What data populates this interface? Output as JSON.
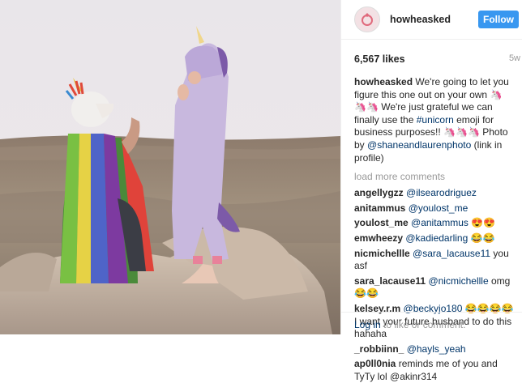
{
  "account": {
    "username": "howheasked",
    "follow_label": "Follow"
  },
  "post": {
    "likes": "6,567 likes",
    "age": "5w",
    "caption_user": "howheasked",
    "caption_text_1": "We're going to let you figure this one out on your own 🦄🦄🦄 We're just grateful we can finally use the ",
    "caption_hashtag": "#unicorn",
    "caption_text_2": " emoji for business purposes!! 🦄🦄🦄 Photo by ",
    "caption_mention": "@shaneandlaurenphoto",
    "caption_text_3": " (link in profile)"
  },
  "load_more": "load more comments",
  "comments": [
    {
      "user": "angellygzz",
      "mention": "@ilsearodriguez",
      "text": ""
    },
    {
      "user": "anitammus",
      "mention": "@youlost_me",
      "text": ""
    },
    {
      "user": "youlost_me",
      "mention": "@anitammus",
      "text": " 😍😍"
    },
    {
      "user": "emwheezy",
      "mention": "@kadiedarling",
      "text": " 😂😂"
    },
    {
      "user": "nicmichellle",
      "mention": "@sara_lacause11",
      "text": " you asf"
    },
    {
      "user": "sara_lacause11",
      "mention": "@nicmichellle",
      "text": " omg😂😂"
    },
    {
      "user": "kelsey.r.m",
      "mention": "@beckyjo180",
      "text": " 😂😂😂😂I want your future husband to do this hahaha"
    },
    {
      "user": "_robbiinn_",
      "mention": "@hayls_yeah",
      "text": ""
    },
    {
      "user": "ap0ll0nia",
      "mention": "",
      "text": "reminds me of you and TyTy lol @akinr314"
    }
  ],
  "footer": {
    "login": "Log in",
    "rest": " to like or comment."
  },
  "colors": {
    "follow_button": "#3897f0",
    "link": "#003569",
    "muted": "#999999"
  }
}
